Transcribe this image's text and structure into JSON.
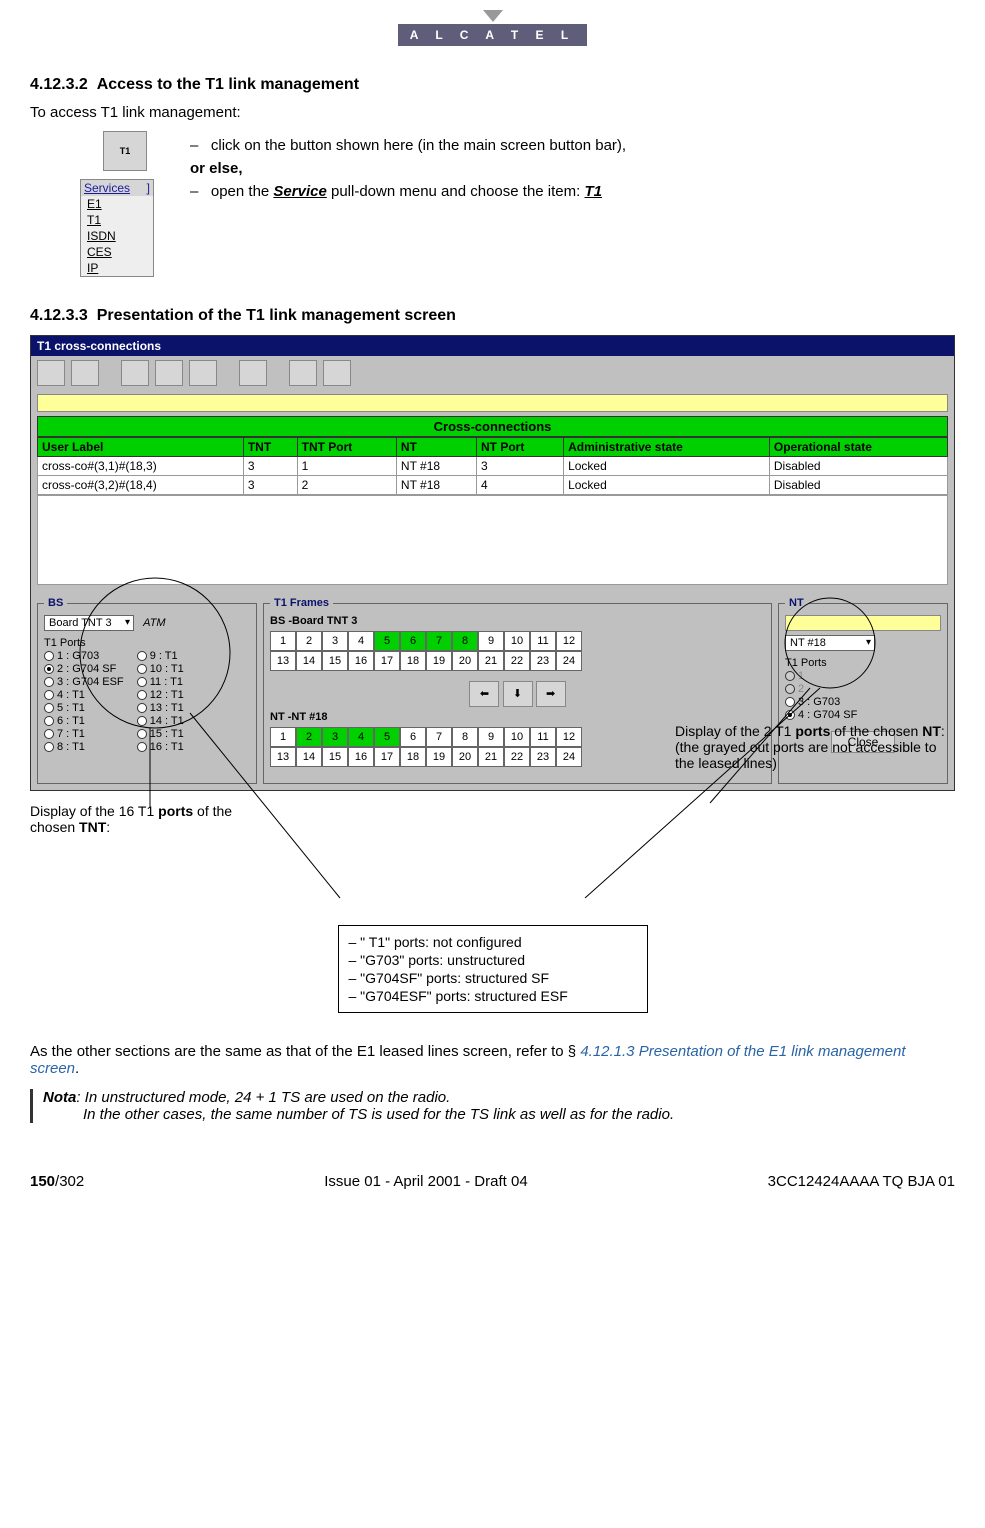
{
  "logo": "A L C A T E L",
  "sec1": {
    "num": "4.12.3.2",
    "title": "Access to the T1 link management"
  },
  "intro": "To access T1 link management:",
  "bullet1": "click on the button shown here (in the main screen button bar),",
  "orelse": "or else,",
  "bullet2a": "open the ",
  "bullet2b": "Service",
  "bullet2c": " pull-down menu and choose the item: ",
  "bullet2d": "T1",
  "svc": {
    "head": "Services",
    "items": [
      "E1",
      "T1",
      "ISDN",
      "CES",
      "IP"
    ]
  },
  "sec2": {
    "num": "4.12.3.3",
    "title": "Presentation of the T1 link management screen"
  },
  "win": {
    "title": "T1 cross-connections",
    "cx_head": "Cross-connections",
    "cols": [
      "User Label",
      "TNT",
      "TNT Port",
      "NT",
      "NT Port",
      "Administrative state",
      "Operational state"
    ],
    "rows": [
      [
        "cross-co#(3,1)#(18,3)",
        "3",
        "1",
        "NT #18",
        "3",
        "Locked",
        "Disabled"
      ],
      [
        "cross-co#(3,2)#(18,4)",
        "3",
        "2",
        "NT #18",
        "4",
        "Locked",
        "Disabled"
      ]
    ],
    "bs_label": "BS",
    "bs_board": "Board TNT 3",
    "bs_atm": "ATM",
    "bs_ports_label": "T1 Ports",
    "bs_ports_l": [
      "1 : G703",
      "2 : G704 SF",
      "3 : G704 ESF",
      "4 : T1",
      "5 : T1",
      "6 : T1",
      "7 : T1",
      "8 : T1"
    ],
    "bs_ports_r": [
      "9 : T1",
      "10 : T1",
      "11 : T1",
      "12 : T1",
      "13 : T1",
      "14 : T1",
      "15 : T1",
      "16 : T1"
    ],
    "t1f_label": "T1 Frames",
    "bs_board_lbl": "BS -Board TNT 3",
    "nt_frame_lbl": "NT -NT #18",
    "nt_label": "NT",
    "nt_sel": "NT #18",
    "nt_ports_label": "T1 Ports",
    "nt_ports": [
      "1",
      "2",
      "3 : G703",
      "4 : G704 SF"
    ],
    "close": "Close"
  },
  "ann": {
    "left1": "Display of the 16 T1 ",
    "left2": "ports",
    "left3": " of the chosen ",
    "left4": "TNT",
    "left5": ":",
    "right1": "Display of the 2 T1 ",
    "right2": "ports",
    "right3": " of the chosen ",
    "right4": "NT",
    "right5": ": (the grayed out ports are not accessible to the leased lines)",
    "box": [
      "– \" T1\" ports: not configured",
      "– \"G703\" ports: unstructured",
      "– \"G704SF\" ports: structured SF",
      "– \"G704ESF\" ports: structured ESF"
    ]
  },
  "bot1a": "As the other sections are the same as that of the E1 leased lines screen, refer to § ",
  "bot1b": "4.12.1.3 Presentation of the E1 link management screen",
  "bot1c": ".",
  "nota_label": "Nota",
  "nota1": ": In unstructured mode, 24 + 1 TS are used on the radio.",
  "nota2": "In the other cases, the same number of TS is used for the TS link as well as for the radio.",
  "footer": {
    "page": "150/302",
    "issue": "Issue 01 - April 2001 - Draft 04",
    "doc": "3CC12424AAAA TQ BJA 01"
  }
}
